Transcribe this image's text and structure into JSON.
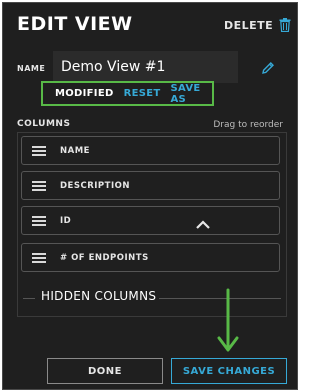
{
  "header": {
    "title": "EDIT VIEW",
    "delete_label": "DELETE",
    "delete_icon": "trash-icon"
  },
  "name_field": {
    "label": "NAME",
    "value": "Demo View #1",
    "edit_icon": "pencil-icon"
  },
  "status": {
    "modified_label": "MODIFIED",
    "reset_label": "RESET",
    "save_as_label": "SAVE AS"
  },
  "columns": {
    "label": "COLUMNS",
    "reorder_hint": "Drag to reorder",
    "items": [
      {
        "label": "NAME"
      },
      {
        "label": "DESCRIPTION"
      },
      {
        "label": "ID",
        "icon": "chevron-up-icon"
      },
      {
        "label": "# OF ENDPOINTS"
      }
    ]
  },
  "hidden_columns": {
    "label": "HIDDEN COLUMNS"
  },
  "footer": {
    "done_label": "DONE",
    "save_label": "SAVE CHANGES"
  },
  "colors": {
    "accent": "#36a9d6",
    "highlight": "#58b947",
    "panel_bg": "#1f1f1f"
  }
}
